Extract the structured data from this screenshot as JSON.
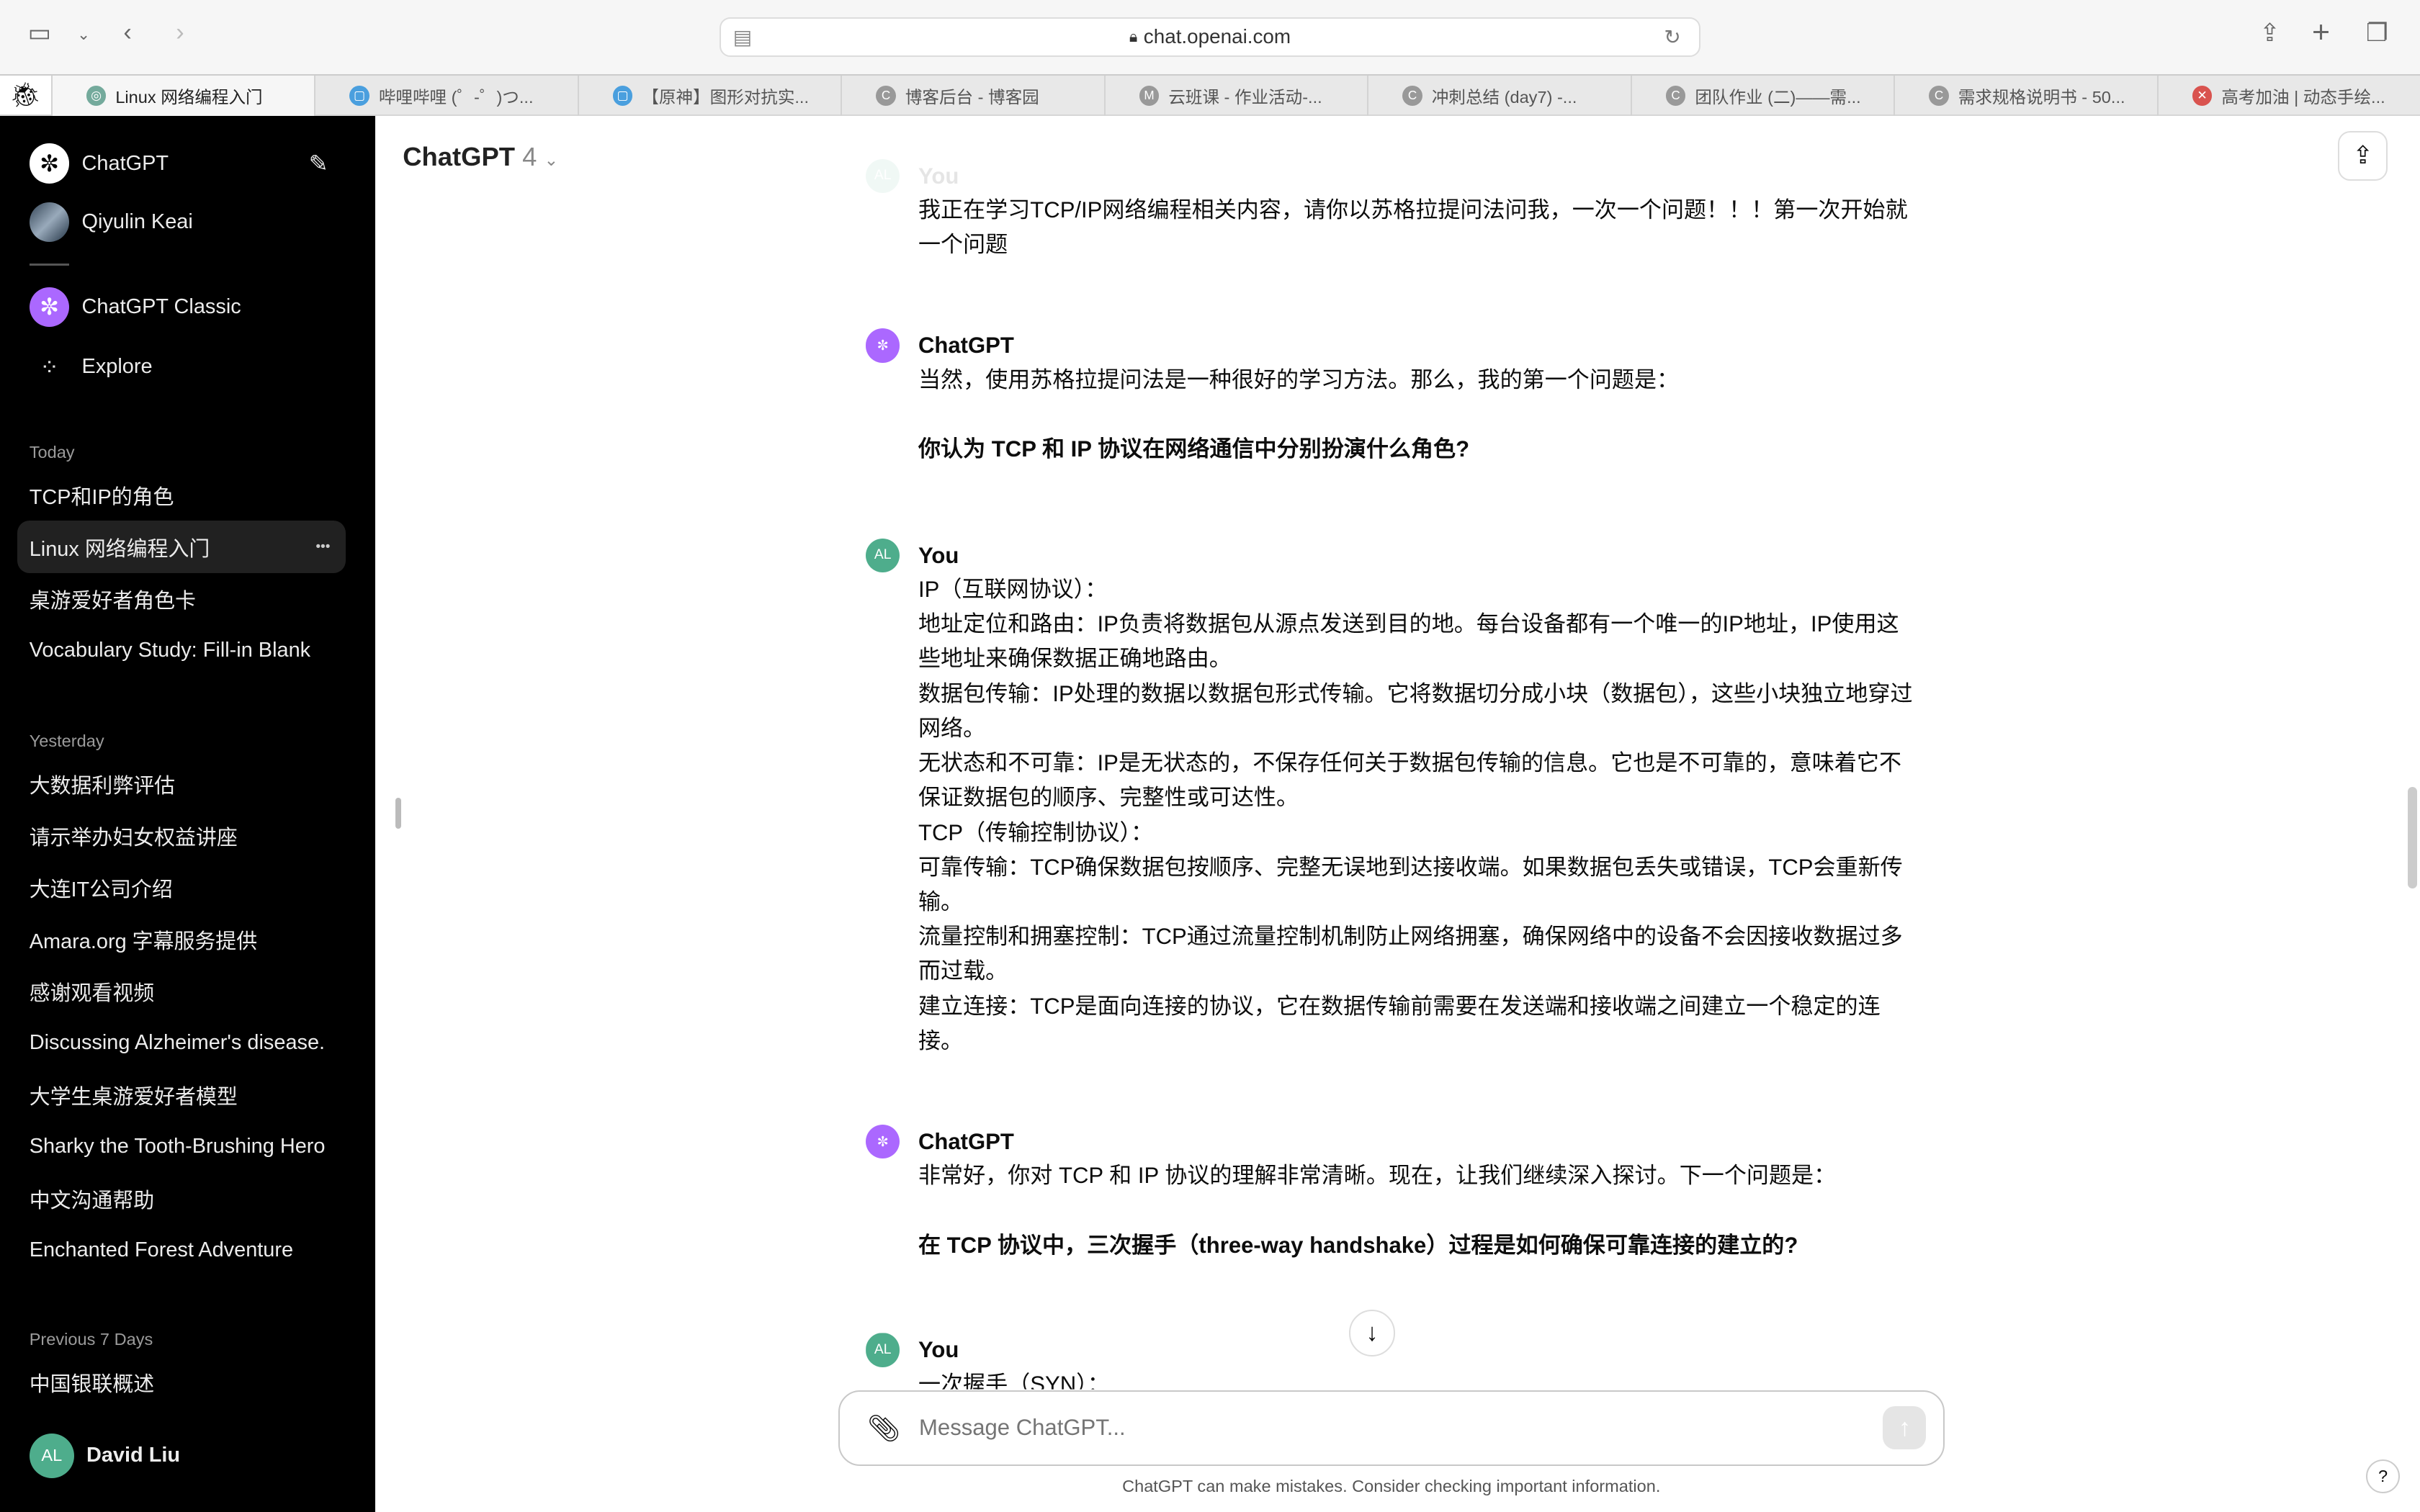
{
  "browser": {
    "url": "chat.openai.com",
    "tabs": [
      {
        "label": "Linux 网络编程入门",
        "fav": "◎",
        "color": "#74aa9c",
        "active": true
      },
      {
        "label": "哔哩哔哩 (゜-゜)つ...",
        "fav": "▢",
        "color": "#4a9fde"
      },
      {
        "label": "【原神】图形对抗实...",
        "fav": "▢",
        "color": "#4a9fde"
      },
      {
        "label": "博客后台 - 博客园",
        "fav": "C",
        "color": "#999"
      },
      {
        "label": "云班课 - 作业活动-...",
        "fav": "M",
        "color": "#999"
      },
      {
        "label": "冲刺总结 (day7) -...",
        "fav": "C",
        "color": "#999"
      },
      {
        "label": "团队作业 (二)——需...",
        "fav": "C",
        "color": "#999"
      },
      {
        "label": "需求规格说明书 - 50...",
        "fav": "C",
        "color": "#999"
      },
      {
        "label": "高考加油 | 动态手绘...",
        "fav": "✕",
        "color": "#d9534f"
      }
    ]
  },
  "sidebar": {
    "app": "ChatGPT",
    "gpt_user": "Qiyulin Keai",
    "classic": "ChatGPT Classic",
    "explore": "Explore",
    "sections": [
      {
        "title": "Today",
        "items": [
          "TCP和IP的角色",
          "Linux 网络编程入门",
          "桌游爱好者角色卡",
          "Vocabulary Study: Fill-in Blank"
        ]
      },
      {
        "title": "Yesterday",
        "items": [
          "大数据利弊评估",
          "请示举办妇女权益讲座",
          "大连IT公司介绍",
          "Amara.org 字幕服务提供",
          "感谢观看视频",
          "Discussing Alzheimer's disease.",
          "大学生桌游爱好者模型",
          "Sharky the Tooth-Brushing Hero",
          "中文沟通帮助",
          "Enchanted Forest Adventure"
        ]
      },
      {
        "title": "Previous 7 Days",
        "items": [
          "中国银联概述"
        ]
      }
    ],
    "user": {
      "initials": "AL",
      "name": "David Liu"
    }
  },
  "main": {
    "model": "ChatGPT",
    "version": "4",
    "messages": [
      {
        "who": "You",
        "lines": [
          "我正在学习TCP/IP网络编程相关内容，请你以苏格拉提问法问我，一次一个问题！！！第一次开始就一个问题"
        ]
      },
      {
        "who": "ChatGPT",
        "lines": [
          "当然，使用苏格拉提问法是一种很好的学习方法。那么，我的第一个问题是："
        ],
        "bold": "你认为 TCP 和 IP 协议在网络通信中分别扮演什么角色?"
      },
      {
        "who": "You",
        "lines": [
          "IP（互联网协议）：",
          "地址定位和路由：IP负责将数据包从源点发送到目的地。每台设备都有一个唯一的IP地址，IP使用这些地址来确保数据正确地路由。",
          "数据包传输：IP处理的数据以数据包形式传输。它将数据切分成小块（数据包），这些小块独立地穿过网络。",
          "无状态和不可靠：IP是无状态的，不保存任何关于数据包传输的信息。它也是不可靠的，意味着它不保证数据包的顺序、完整性或可达性。",
          "TCP（传输控制协议）：",
          "可靠传输：TCP确保数据包按顺序、完整无误地到达接收端。如果数据包丢失或错误，TCP会重新传输。",
          "流量控制和拥塞控制：TCP通过流量控制机制防止网络拥塞，确保网络中的设备不会因接收数据过多而过载。",
          "建立连接：TCP是面向连接的协议，它在数据传输前需要在发送端和接收端之间建立一个稳定的连接。"
        ]
      },
      {
        "who": "ChatGPT",
        "lines": [
          "非常好，你对 TCP 和 IP 协议的理解非常清晰。现在，让我们继续深入探讨。下一个问题是："
        ],
        "bold": "在 TCP 协议中，三次握手（three-way handshake）过程是如何确保可靠连接的建立的?"
      },
      {
        "who": "You",
        "lines": [
          "一次握手（SYN）："
        ]
      }
    ],
    "input_placeholder": "Message ChatGPT...",
    "disclaimer": "ChatGPT can make mistakes. Consider checking important information.",
    "help": "?"
  }
}
